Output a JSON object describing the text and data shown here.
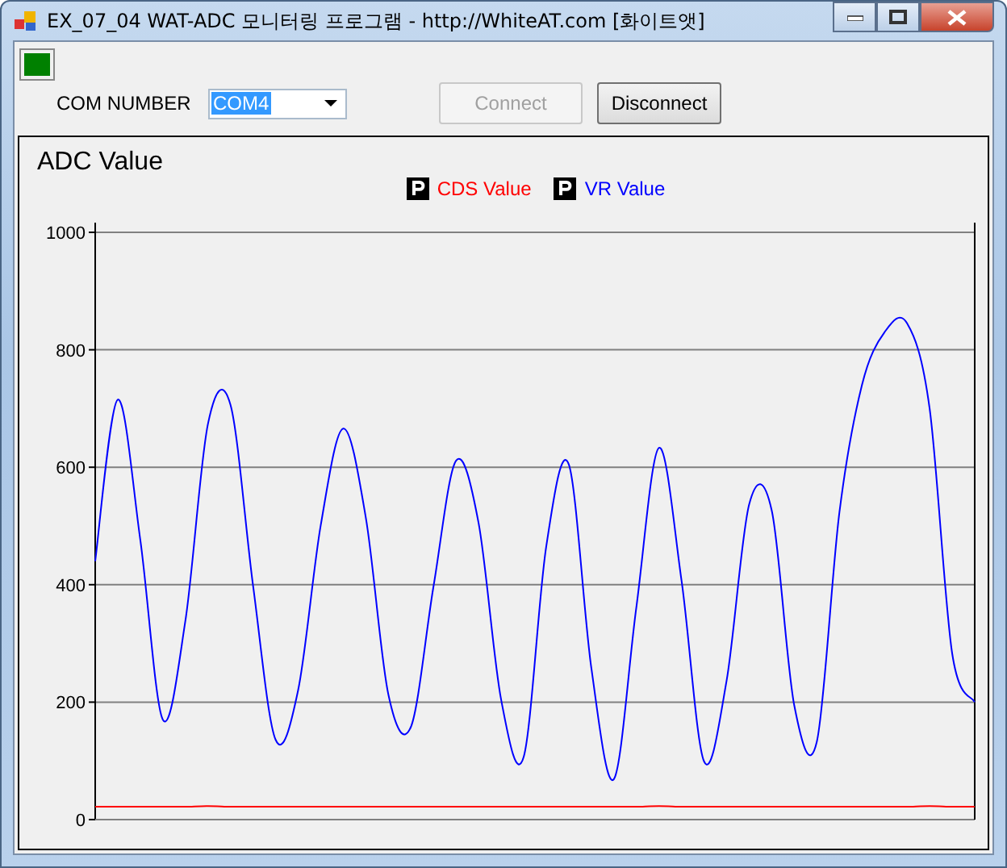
{
  "window": {
    "title": "EX_07_04 WAT-ADC 모니터링 프로그램 - http://WhiteAT.com [화이트앳]"
  },
  "status_led": {
    "on": true,
    "color": "#008000"
  },
  "com_number": {
    "label": "COM NUMBER",
    "value": "COM4"
  },
  "buttons": [
    {
      "label": "Connect",
      "disabled": true
    },
    {
      "label": "Disconnect",
      "disabled": false
    }
  ],
  "chart_panel": {
    "chart_data": {
      "type": "line",
      "title": "ADC Value",
      "ylim": [
        0,
        1000
      ],
      "yticks": [
        0,
        200,
        400,
        600,
        800,
        1000
      ],
      "grid": true,
      "series": [
        {
          "name": "CDS Value",
          "color": "#ff0000",
          "values": [
            22,
            22,
            22,
            22,
            22,
            23,
            22,
            22,
            22,
            22,
            22,
            22,
            22,
            22,
            22,
            22,
            22,
            22,
            22,
            22,
            22,
            22,
            22,
            22,
            22,
            23,
            22,
            22,
            22,
            22,
            22,
            22,
            22,
            22,
            22,
            22,
            22,
            23,
            22,
            22
          ]
        },
        {
          "name": "VR Value",
          "color": "#0000ff",
          "values": [
            440,
            715,
            476,
            170,
            339,
            674,
            706,
            398,
            136,
            221,
            501,
            666,
            514,
            213,
            158,
            397,
            611,
            505,
            204,
            107,
            465,
            605,
            258,
            69,
            363,
            633,
            407,
            99,
            237,
            537,
            526,
            194,
            133,
            523,
            740,
            830,
            845,
            700,
            283,
            200
          ]
        }
      ]
    }
  }
}
